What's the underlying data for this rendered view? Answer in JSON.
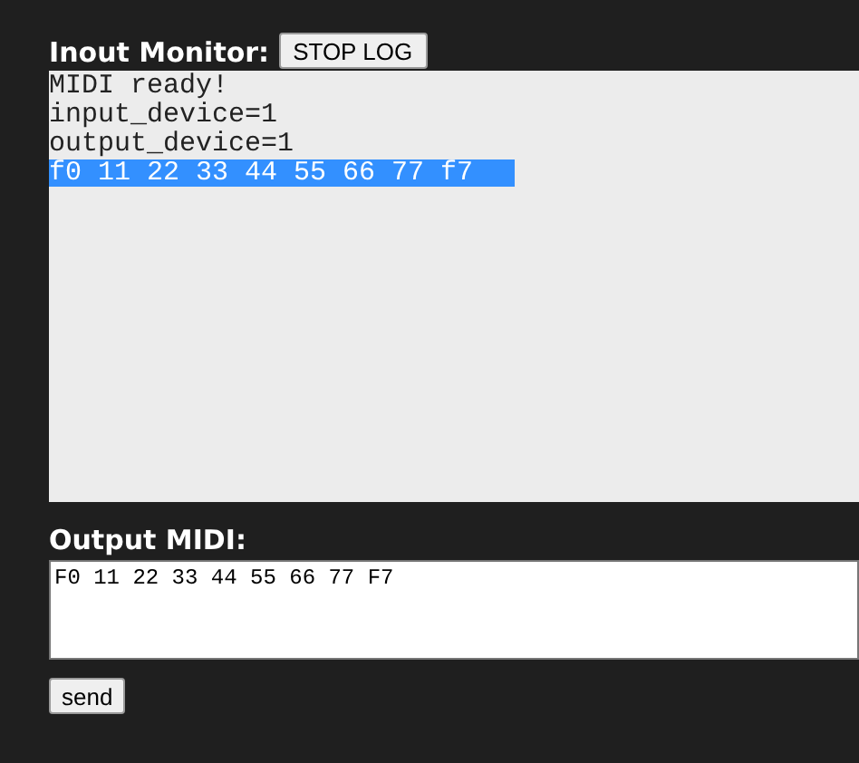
{
  "monitor": {
    "title": "Inout Monitor:",
    "stop_button": "STOP LOG",
    "log_lines": [
      {
        "text": "MIDI ready!",
        "selected": false
      },
      {
        "text": "input_device=1",
        "selected": false
      },
      {
        "text": "output_device=1",
        "selected": false
      },
      {
        "text": "f0 11 22 33 44 55 66 77 f7",
        "selected": true
      }
    ]
  },
  "output": {
    "title": "Output MIDI:",
    "value": "F0 11 22 33 44 55 66 77 F7",
    "send_button": "send"
  }
}
